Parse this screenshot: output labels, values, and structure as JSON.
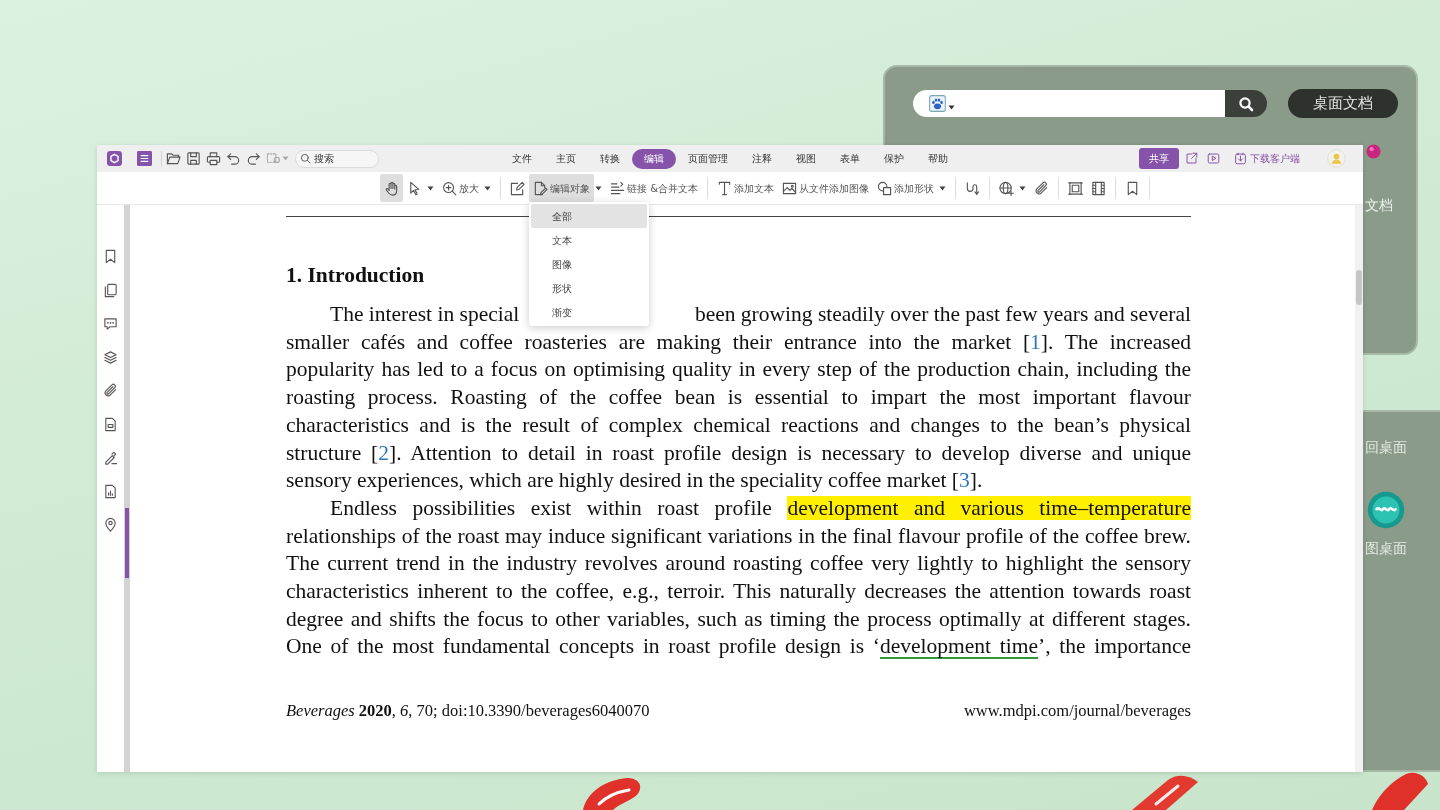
{
  "desktop": {
    "widget": {
      "search": {
        "kind": "web"
      },
      "button": "桌面文档",
      "icon_label": "文档"
    },
    "shortcuts": [
      {
        "kind": "plain",
        "label": "回桌面"
      },
      {
        "kind": "app",
        "label": "图桌面"
      }
    ]
  },
  "menu_bar": {
    "search": {
      "placeholder": "搜索"
    },
    "tabs": [
      {
        "label": "文件",
        "selected": false
      },
      {
        "label": "主页",
        "selected": false
      },
      {
        "label": "转换",
        "selected": false
      },
      {
        "label": "编辑",
        "selected": true
      },
      {
        "label": "页面管理",
        "selected": false
      },
      {
        "label": "注释",
        "selected": false
      },
      {
        "label": "视图",
        "selected": false
      },
      {
        "label": "表单",
        "selected": false
      },
      {
        "label": "保护",
        "selected": false
      },
      {
        "label": "帮助",
        "selected": false
      }
    ],
    "share_button": "共享",
    "download_link": "下载客户端"
  },
  "toolbar": [
    {
      "kind": "hand",
      "selected": true
    },
    {
      "kind": "pointer",
      "selected": false,
      "caret": true
    },
    {
      "kind": "zoom",
      "label": "放大",
      "selected": false,
      "caret": true
    },
    {
      "kind": "separator"
    },
    {
      "kind": "edit",
      "selected": false
    },
    {
      "kind": "edit-object",
      "label": "编辑对象",
      "selected": true,
      "caret": true,
      "menu": [
        {
          "label": "全部",
          "selected": true
        },
        {
          "label": "文本",
          "selected": false
        },
        {
          "label": "图像",
          "selected": false
        },
        {
          "label": "形状",
          "selected": false
        },
        {
          "label": "渐变",
          "selected": false
        }
      ]
    },
    {
      "kind": "link",
      "label": "链接 &合并文本",
      "selected": false
    },
    {
      "kind": "separator"
    },
    {
      "kind": "text",
      "label": "添加文本",
      "selected": false
    },
    {
      "kind": "image",
      "label": "从文件添加图像",
      "selected": false
    },
    {
      "kind": "shape",
      "label": "添加形状",
      "selected": false,
      "caret": true
    },
    {
      "kind": "separator"
    },
    {
      "kind": "curve",
      "selected": false
    },
    {
      "kind": "separator"
    },
    {
      "kind": "globe",
      "selected": false,
      "caret": true
    },
    {
      "kind": "attach",
      "selected": false
    },
    {
      "kind": "separator"
    },
    {
      "kind": "frame",
      "selected": false
    },
    {
      "kind": "film",
      "selected": false
    },
    {
      "kind": "separator"
    },
    {
      "kind": "bookmark",
      "selected": false
    },
    {
      "kind": "separator"
    }
  ],
  "document": {
    "heading": "1. Introduction",
    "paragraphs": [
      {
        "continues": false,
        "lines": [
          {
            "parts": [
              [
                {
                  "kind": "text",
                  "text": "The interest in special"
                }
              ],
              [
                {
                  "kind": "text",
                  "text": "been growing steadily over the past few years and several"
                }
              ]
            ]
          },
          {
            "parts": [
              [
                {
                  "kind": "text",
                  "text": "smaller cafés and coffee roasteries are making their entrance into the market ["
                },
                {
                  "kind": "cite",
                  "text": "1"
                },
                {
                  "kind": "text",
                  "text": "]. The increased"
                }
              ]
            ]
          },
          {
            "parts": [
              [
                {
                  "kind": "text",
                  "text": "popularity has led to a focus on optimising quality in every step of the production chain, including the"
                }
              ]
            ]
          },
          {
            "parts": [
              [
                {
                  "kind": "text",
                  "text": "roasting process. Roasting of the coffee bean is essential to impart the most important flavour"
                }
              ]
            ]
          },
          {
            "parts": [
              [
                {
                  "kind": "text",
                  "text": "characteristics and is the result of complex chemical reactions and changes to the bean’s physical"
                }
              ]
            ]
          },
          {
            "parts": [
              [
                {
                  "kind": "text",
                  "text": "structure ["
                },
                {
                  "kind": "cite",
                  "text": "2"
                },
                {
                  "kind": "text",
                  "text": "]. Attention to detail in roast profile design is necessary to develop diverse and unique"
                }
              ]
            ]
          },
          {
            "parts": [
              [
                {
                  "kind": "text",
                  "text": "sensory experiences, which are highly desired in the speciality coffee market ["
                },
                {
                  "kind": "cite",
                  "text": "3"
                },
                {
                  "kind": "text",
                  "text": "]."
                }
              ]
            ]
          }
        ]
      },
      {
        "continues": true,
        "lines": [
          {
            "parts": [
              [
                {
                  "kind": "text",
                  "text": "Endless possibilities exist within roast profile "
                },
                {
                  "kind": "highlight",
                  "text": "development and various time–temperature"
                }
              ]
            ]
          },
          {
            "parts": [
              [
                {
                  "kind": "text",
                  "text": "relationships of the roast may induce significant variations in the final flavour profile of the coffee brew."
                }
              ]
            ]
          },
          {
            "parts": [
              [
                {
                  "kind": "text",
                  "text": "The current trend in the industry revolves around roasting coffee very lightly to highlight the sensory"
                }
              ]
            ]
          },
          {
            "parts": [
              [
                {
                  "kind": "text",
                  "text": "characteristics inherent to the coffee, e.g., terroir. This naturally decreases the attention towards roast"
                }
              ]
            ]
          },
          {
            "parts": [
              [
                {
                  "kind": "text",
                  "text": "degree and shifts the focus to other variables, such as timing the process optimally at different stages."
                }
              ]
            ]
          },
          {
            "parts": [
              [
                {
                  "kind": "text",
                  "text": "One of the most fundamental concepts in roast profile design is ‘"
                },
                {
                  "kind": "underline",
                  "text": "development time"
                },
                {
                  "kind": "text",
                  "text": "’, the importance"
                }
              ]
            ]
          }
        ]
      }
    ],
    "footer": {
      "left": "*Beverages* **2020**, *6*, 70; doi:10.3390/beverages6040070",
      "right": "www.mdpi.com/journal/beverages"
    }
  }
}
